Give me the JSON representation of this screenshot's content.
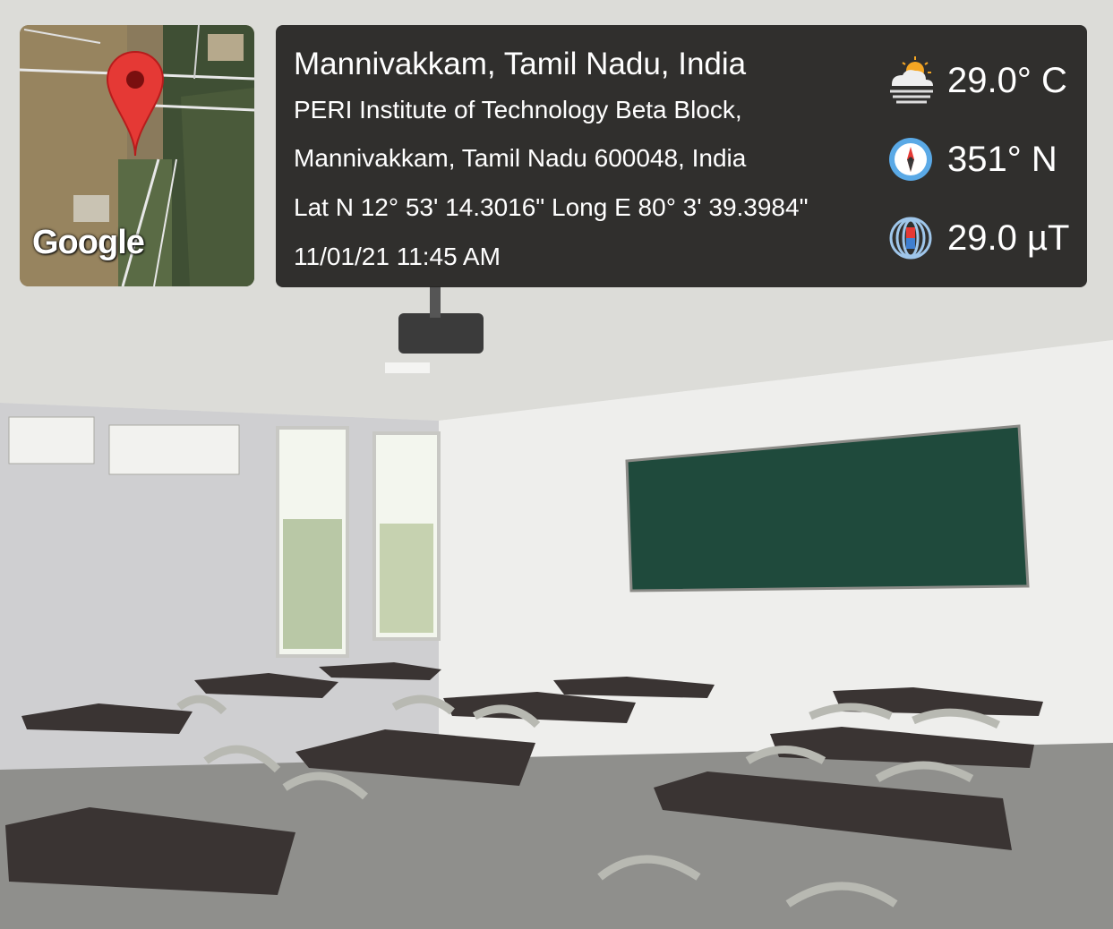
{
  "map": {
    "brand": "Google"
  },
  "location": {
    "title": "Mannivakkam, Tamil Nadu, India",
    "address_line1": "PERI Institute of Technology Beta Block,",
    "address_line2": "Mannivakkam, Tamil Nadu 600048, India",
    "coordinates": "Lat N 12° 53' 14.3016\" Long E 80° 3' 39.3984\"",
    "datetime": "11/01/21 11:45 AM"
  },
  "metrics": {
    "temperature": {
      "icon": "weather-sun-cloud-icon",
      "value": "29.0° C"
    },
    "heading": {
      "icon": "compass-icon",
      "value": "351° N"
    },
    "magnetic": {
      "icon": "magnetic-field-icon",
      "value": "29.0 µT"
    }
  },
  "colors": {
    "panel_bg": "#22211f",
    "pin_red": "#e53935",
    "chalkboard": "#1f4a3c"
  }
}
